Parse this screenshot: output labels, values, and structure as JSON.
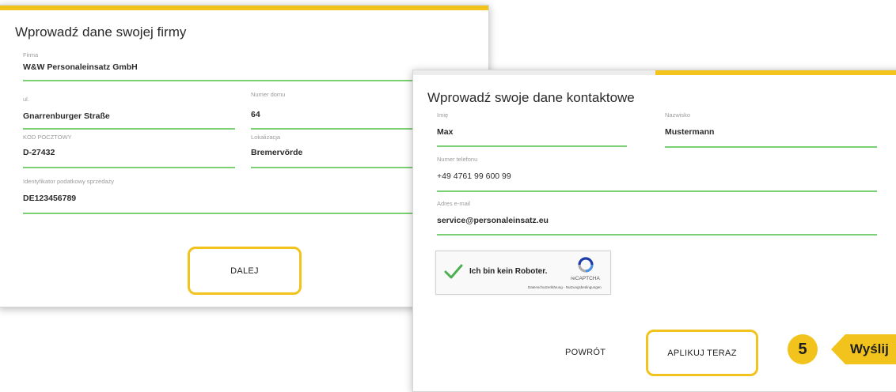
{
  "company_form": {
    "title": "Wprowadź dane swojej firmy",
    "firma": {
      "label": "Firma",
      "value": "W&W Personaleinsatz GmbH"
    },
    "ulica": {
      "label": "ul.",
      "value": "Gnarrenburger Straße"
    },
    "numer_domu": {
      "label": "Numer domu",
      "value": "64"
    },
    "kod_pocztowy": {
      "label": "KOD POCZTOWY",
      "value": "D-27432"
    },
    "lokalizacja": {
      "label": "Lokalizacja",
      "value": "Bremervörde"
    },
    "identyfikator": {
      "label": "Identyfikator podatkowy sprzedaży",
      "value": "DE123456789"
    },
    "next_button": "DALEJ"
  },
  "contact_form": {
    "title": "Wprowadź swoje dane kontaktowe",
    "imie": {
      "label": "Imię",
      "value": "Max"
    },
    "nazwisko": {
      "label": "Nazwisko",
      "value": "Mustermann"
    },
    "telefon": {
      "label": "Numer telefonu",
      "value": "+49 4761 99 600 99"
    },
    "email": {
      "label": "Adres e-mail",
      "value": "service@personaleinsatz.eu"
    },
    "captcha": {
      "text": "Ich bin kein Roboter.",
      "brand": "reCAPTCHA",
      "links": "Datenschutzerklärung - Nutzungsbedingungen"
    },
    "back_button": "POWRÓT",
    "apply_button": "APLIKUJ TERAZ"
  },
  "step": {
    "number": "5",
    "label": "Wyślij"
  },
  "colors": {
    "accent": "#f2c31c",
    "underline": "#7bcf74",
    "check": "#4caf50"
  }
}
